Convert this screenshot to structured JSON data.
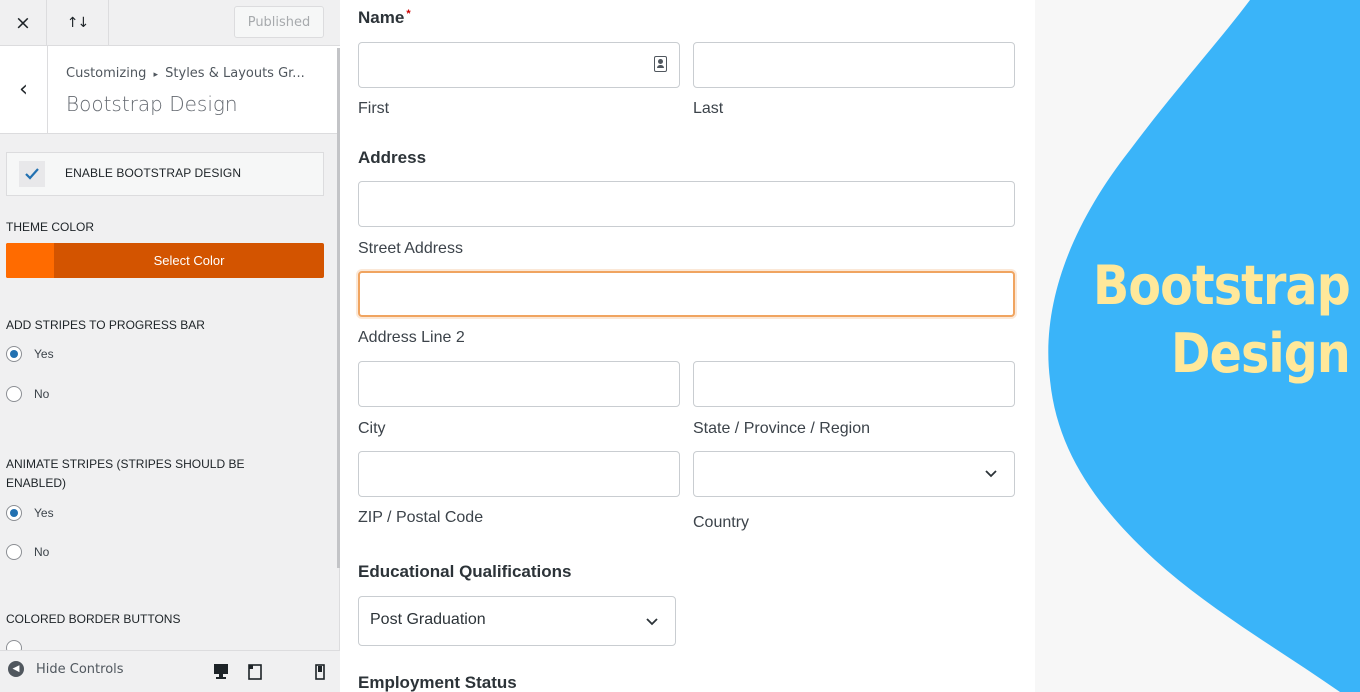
{
  "toolbar": {
    "close_icon": "×",
    "sort_icon": "↑↓",
    "published_label": "Published"
  },
  "section": {
    "breadcrumb_root": "Customizing",
    "breadcrumb_sep": "▸",
    "breadcrumb_current": "Styles & Layouts Gr...",
    "title": "Bootstrap Design",
    "back_icon": "‹"
  },
  "controls": {
    "enable_label": "ENABLE BOOTSTRAP DESIGN",
    "enable_checked": true,
    "theme_color_label": "THEME COLOR",
    "select_color_label": "Select Color",
    "theme_color_value": "#d35400",
    "stripes_label": "ADD STRIPES TO PROGRESS BAR",
    "stripes_yes": "Yes",
    "stripes_no": "No",
    "animate_label": "ANIMATE STRIPES (STRIPES SHOULD BE ENABLED)",
    "animate_yes": "Yes",
    "animate_no": "No",
    "colored_border_label": "COLORED BORDER BUTTONS"
  },
  "footer": {
    "hide_controls_label": "Hide Controls"
  },
  "form": {
    "name_label": "Name",
    "required_mark": "*",
    "first_label": "First",
    "last_label": "Last",
    "address_label": "Address",
    "street_label": "Street Address",
    "line2_label": "Address Line 2",
    "city_label": "City",
    "state_label": "State / Province / Region",
    "zip_label": "ZIP / Postal Code",
    "country_label": "Country",
    "education_label": "Educational Qualifications",
    "education_value": "Post Graduation",
    "employment_label": "Employment Status"
  },
  "banner": {
    "line1": "Bootstrap",
    "line2": "Design",
    "blob_color": "#3ab4f9",
    "text_color": "#ffe89a"
  }
}
